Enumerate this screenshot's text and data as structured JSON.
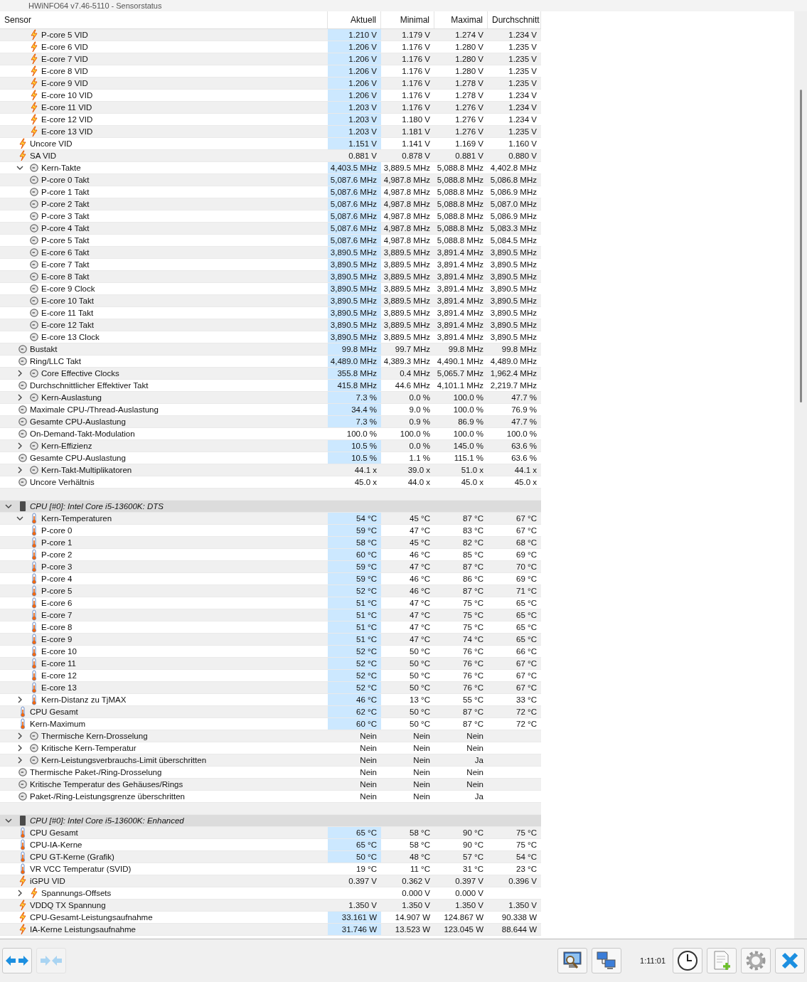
{
  "window": {
    "title": "HWiNFO64 v7.46-5110 - Sensorstatus"
  },
  "columns": [
    "Sensor",
    "Aktuell",
    "Minimal",
    "Maximal",
    "Durchschnitt"
  ],
  "sections": [
    {
      "rows": [
        {
          "children": [
            {
              "label": "P-core 5 VID",
              "kind": "volt",
              "highlighted": true,
              "current": "1.210 V",
              "min": "1.179 V",
              "max": "1.274 V",
              "avg": "1.234 V"
            },
            {
              "label": "E-core 6 VID",
              "kind": "volt",
              "highlighted": true,
              "current": "1.206 V",
              "min": "1.176 V",
              "max": "1.280 V",
              "avg": "1.235 V"
            },
            {
              "label": "E-core 7 VID",
              "kind": "volt",
              "highlighted": true,
              "current": "1.206 V",
              "min": "1.176 V",
              "max": "1.280 V",
              "avg": "1.235 V"
            },
            {
              "label": "E-core 8 VID",
              "kind": "volt",
              "highlighted": true,
              "current": "1.206 V",
              "min": "1.176 V",
              "max": "1.280 V",
              "avg": "1.235 V"
            },
            {
              "label": "E-core 9 VID",
              "kind": "volt",
              "highlighted": true,
              "current": "1.206 V",
              "min": "1.176 V",
              "max": "1.278 V",
              "avg": "1.235 V"
            },
            {
              "label": "E-core 10 VID",
              "kind": "volt",
              "highlighted": true,
              "current": "1.206 V",
              "min": "1.176 V",
              "max": "1.278 V",
              "avg": "1.234 V"
            },
            {
              "label": "E-core 11 VID",
              "kind": "volt",
              "highlighted": true,
              "current": "1.203 V",
              "min": "1.176 V",
              "max": "1.276 V",
              "avg": "1.234 V"
            },
            {
              "label": "E-core 12 VID",
              "kind": "volt",
              "highlighted": true,
              "current": "1.203 V",
              "min": "1.180 V",
              "max": "1.276 V",
              "avg": "1.234 V"
            },
            {
              "label": "E-core 13 VID",
              "kind": "volt",
              "highlighted": true,
              "current": "1.203 V",
              "min": "1.181 V",
              "max": "1.276 V",
              "avg": "1.235 V"
            }
          ]
        },
        {
          "label": "Uncore VID",
          "kind": "volt",
          "highlighted": true,
          "current": "1.151 V",
          "min": "1.141 V",
          "max": "1.169 V",
          "avg": "1.160 V"
        },
        {
          "label": "SA VID",
          "kind": "volt",
          "highlighted": false,
          "current": "0.881 V",
          "min": "0.878 V",
          "max": "0.881 V",
          "avg": "0.880 V"
        },
        {
          "label": "Kern-Takte",
          "kind": "gauge",
          "expanded": true,
          "highlighted": true,
          "current": "4,403.5 MHz",
          "min": "3,889.5 MHz",
          "max": "5,088.8 MHz",
          "avg": "4,402.8 MHz",
          "children": [
            {
              "label": "P-core 0 Takt",
              "kind": "gauge",
              "highlighted": true,
              "current": "5,087.6 MHz",
              "min": "4,987.8 MHz",
              "max": "5,088.8 MHz",
              "avg": "5,086.8 MHz"
            },
            {
              "label": "P-core 1 Takt",
              "kind": "gauge",
              "highlighted": true,
              "current": "5,087.6 MHz",
              "min": "4,987.8 MHz",
              "max": "5,088.8 MHz",
              "avg": "5,086.9 MHz"
            },
            {
              "label": "P-core 2 Takt",
              "kind": "gauge",
              "highlighted": true,
              "current": "5,087.6 MHz",
              "min": "4,987.8 MHz",
              "max": "5,088.8 MHz",
              "avg": "5,087.0 MHz"
            },
            {
              "label": "P-core 3 Takt",
              "kind": "gauge",
              "highlighted": true,
              "current": "5,087.6 MHz",
              "min": "4,987.8 MHz",
              "max": "5,088.8 MHz",
              "avg": "5,086.9 MHz"
            },
            {
              "label": "P-core 4 Takt",
              "kind": "gauge",
              "highlighted": true,
              "current": "5,087.6 MHz",
              "min": "4,987.8 MHz",
              "max": "5,088.8 MHz",
              "avg": "5,083.3 MHz"
            },
            {
              "label": "P-core 5 Takt",
              "kind": "gauge",
              "highlighted": true,
              "current": "5,087.6 MHz",
              "min": "4,987.8 MHz",
              "max": "5,088.8 MHz",
              "avg": "5,084.5 MHz"
            },
            {
              "label": "E-core 6 Takt",
              "kind": "gauge",
              "highlighted": true,
              "current": "3,890.5 MHz",
              "min": "3,889.5 MHz",
              "max": "3,891.4 MHz",
              "avg": "3,890.5 MHz"
            },
            {
              "label": "E-core 7 Takt",
              "kind": "gauge",
              "highlighted": true,
              "current": "3,890.5 MHz",
              "min": "3,889.5 MHz",
              "max": "3,891.4 MHz",
              "avg": "3,890.5 MHz"
            },
            {
              "label": "E-core 8 Takt",
              "kind": "gauge",
              "highlighted": true,
              "current": "3,890.5 MHz",
              "min": "3,889.5 MHz",
              "max": "3,891.4 MHz",
              "avg": "3,890.5 MHz"
            },
            {
              "label": "E-core 9 Clock",
              "kind": "gauge",
              "highlighted": true,
              "current": "3,890.5 MHz",
              "min": "3,889.5 MHz",
              "max": "3,891.4 MHz",
              "avg": "3,890.5 MHz"
            },
            {
              "label": "E-core 10 Takt",
              "kind": "gauge",
              "highlighted": true,
              "current": "3,890.5 MHz",
              "min": "3,889.5 MHz",
              "max": "3,891.4 MHz",
              "avg": "3,890.5 MHz"
            },
            {
              "label": "E-core 11 Takt",
              "kind": "gauge",
              "highlighted": true,
              "current": "3,890.5 MHz",
              "min": "3,889.5 MHz",
              "max": "3,891.4 MHz",
              "avg": "3,890.5 MHz"
            },
            {
              "label": "E-core 12 Takt",
              "kind": "gauge",
              "highlighted": true,
              "current": "3,890.5 MHz",
              "min": "3,889.5 MHz",
              "max": "3,891.4 MHz",
              "avg": "3,890.5 MHz"
            },
            {
              "label": "E-core 13 Clock",
              "kind": "gauge",
              "highlighted": true,
              "current": "3,890.5 MHz",
              "min": "3,889.5 MHz",
              "max": "3,891.4 MHz",
              "avg": "3,890.5 MHz"
            }
          ]
        },
        {
          "label": "Bustakt",
          "kind": "gauge",
          "highlighted": true,
          "current": "99.8 MHz",
          "min": "99.7 MHz",
          "max": "99.8 MHz",
          "avg": "99.8 MHz"
        },
        {
          "label": "Ring/LLC Takt",
          "kind": "gauge",
          "highlighted": true,
          "current": "4,489.0 MHz",
          "min": "4,389.3 MHz",
          "max": "4,490.1 MHz",
          "avg": "4,489.0 MHz"
        },
        {
          "label": "Core Effective Clocks",
          "kind": "gauge",
          "expanded": false,
          "highlighted": true,
          "current": "355.8 MHz",
          "min": "0.4 MHz",
          "max": "5,065.7 MHz",
          "avg": "1,962.4 MHz"
        },
        {
          "label": "Durchschnittlicher Effektiver Takt",
          "kind": "gauge",
          "highlighted": true,
          "current": "415.8 MHz",
          "min": "44.6 MHz",
          "max": "4,101.1 MHz",
          "avg": "2,219.7 MHz"
        },
        {
          "label": "Kern-Auslastung",
          "kind": "gauge",
          "expanded": false,
          "highlighted": true,
          "current": "7.3 %",
          "min": "0.0 %",
          "max": "100.0 %",
          "avg": "47.7 %"
        },
        {
          "label": "Maximale CPU-/Thread-Auslastung",
          "kind": "gauge",
          "highlighted": true,
          "current": "34.4 %",
          "min": "9.0 %",
          "max": "100.0 %",
          "avg": "76.9 %"
        },
        {
          "label": "Gesamte CPU-Auslastung",
          "kind": "gauge",
          "highlighted": true,
          "current": "7.3 %",
          "min": "0.9 %",
          "max": "86.9 %",
          "avg": "47.7 %"
        },
        {
          "label": "On-Demand-Takt-Modulation",
          "kind": "gauge",
          "highlighted": false,
          "current": "100.0 %",
          "min": "100.0 %",
          "max": "100.0 %",
          "avg": "100.0 %"
        },
        {
          "label": "Kern-Effizienz",
          "kind": "gauge",
          "expanded": false,
          "highlighted": true,
          "current": "10.5 %",
          "min": "0.0 %",
          "max": "145.0 %",
          "avg": "63.6 %"
        },
        {
          "label": "Gesamte CPU-Auslastung",
          "kind": "gauge",
          "highlighted": true,
          "current": "10.5 %",
          "min": "1.1 %",
          "max": "115.1 %",
          "avg": "63.6 %"
        },
        {
          "label": "Kern-Takt-Multiplikatoren",
          "kind": "gauge",
          "expanded": false,
          "highlighted": false,
          "current": "44.1 x",
          "min": "39.0 x",
          "max": "51.0 x",
          "avg": "44.1 x"
        },
        {
          "label": "Uncore Verhältnis",
          "kind": "gauge",
          "highlighted": false,
          "current": "45.0 x",
          "min": "44.0 x",
          "max": "45.0 x",
          "avg": "45.0 x"
        }
      ]
    },
    {
      "title": "CPU [#0]: Intel Core i5-13600K: DTS",
      "expanded": true,
      "rows": [
        {
          "label": "Kern-Temperaturen",
          "kind": "temp",
          "expanded": true,
          "highlighted": true,
          "current": "54 °C",
          "min": "45 °C",
          "max": "87 °C",
          "avg": "67 °C",
          "children": [
            {
              "label": "P-core 0",
              "kind": "temp",
              "highlighted": true,
              "current": "59 °C",
              "min": "47 °C",
              "max": "83 °C",
              "avg": "67 °C"
            },
            {
              "label": "P-core 1",
              "kind": "temp",
              "highlighted": true,
              "current": "58 °C",
              "min": "45 °C",
              "max": "82 °C",
              "avg": "68 °C"
            },
            {
              "label": "P-core 2",
              "kind": "temp",
              "highlighted": true,
              "current": "60 °C",
              "min": "46 °C",
              "max": "85 °C",
              "avg": "69 °C"
            },
            {
              "label": "P-core 3",
              "kind": "temp",
              "highlighted": true,
              "current": "59 °C",
              "min": "47 °C",
              "max": "87 °C",
              "avg": "70 °C"
            },
            {
              "label": "P-core 4",
              "kind": "temp",
              "highlighted": true,
              "current": "59 °C",
              "min": "46 °C",
              "max": "86 °C",
              "avg": "69 °C"
            },
            {
              "label": "P-core 5",
              "kind": "temp",
              "highlighted": true,
              "current": "52 °C",
              "min": "46 °C",
              "max": "87 °C",
              "avg": "71 °C"
            },
            {
              "label": "E-core 6",
              "kind": "temp",
              "highlighted": true,
              "current": "51 °C",
              "min": "47 °C",
              "max": "75 °C",
              "avg": "65 °C"
            },
            {
              "label": "E-core 7",
              "kind": "temp",
              "highlighted": true,
              "current": "51 °C",
              "min": "47 °C",
              "max": "75 °C",
              "avg": "65 °C"
            },
            {
              "label": "E-core 8",
              "kind": "temp",
              "highlighted": true,
              "current": "51 °C",
              "min": "47 °C",
              "max": "75 °C",
              "avg": "65 °C"
            },
            {
              "label": "E-core 9",
              "kind": "temp",
              "highlighted": true,
              "current": "51 °C",
              "min": "47 °C",
              "max": "74 °C",
              "avg": "65 °C"
            },
            {
              "label": "E-core 10",
              "kind": "temp",
              "highlighted": true,
              "current": "52 °C",
              "min": "50 °C",
              "max": "76 °C",
              "avg": "66 °C"
            },
            {
              "label": "E-core 11",
              "kind": "temp",
              "highlighted": true,
              "current": "52 °C",
              "min": "50 °C",
              "max": "76 °C",
              "avg": "67 °C"
            },
            {
              "label": "E-core 12",
              "kind": "temp",
              "highlighted": true,
              "current": "52 °C",
              "min": "50 °C",
              "max": "76 °C",
              "avg": "67 °C"
            },
            {
              "label": "E-core 13",
              "kind": "temp",
              "highlighted": true,
              "current": "52 °C",
              "min": "50 °C",
              "max": "76 °C",
              "avg": "67 °C"
            }
          ]
        },
        {
          "label": "Kern-Distanz zu TjMAX",
          "kind": "temp",
          "expanded": false,
          "highlighted": true,
          "current": "46 °C",
          "min": "13 °C",
          "max": "55 °C",
          "avg": "33 °C"
        },
        {
          "label": "CPU Gesamt",
          "kind": "temp",
          "highlighted": true,
          "current": "62 °C",
          "min": "50 °C",
          "max": "87 °C",
          "avg": "72 °C"
        },
        {
          "label": "Kern-Maximum",
          "kind": "temp",
          "highlighted": true,
          "current": "60 °C",
          "min": "50 °C",
          "max": "87 °C",
          "avg": "72 °C"
        },
        {
          "label": "Thermische Kern-Drosselung",
          "kind": "gauge",
          "expanded": false,
          "highlighted": false,
          "current": "Nein",
          "min": "Nein",
          "max": "Nein"
        },
        {
          "label": "Kritische Kern-Temperatur",
          "kind": "gauge",
          "expanded": false,
          "highlighted": false,
          "current": "Nein",
          "min": "Nein",
          "max": "Nein"
        },
        {
          "label": "Kern-Leistungsverbrauchs-Limit überschritten",
          "kind": "gauge",
          "expanded": false,
          "highlighted": false,
          "current": "Nein",
          "min": "Nein",
          "max": "Ja"
        },
        {
          "label": "Thermische Paket-/Ring-Drosselung",
          "kind": "gauge",
          "highlighted": false,
          "current": "Nein",
          "min": "Nein",
          "max": "Nein"
        },
        {
          "label": "Kritische Temperatur des Gehäuses/Rings",
          "kind": "gauge",
          "highlighted": false,
          "current": "Nein",
          "min": "Nein",
          "max": "Nein"
        },
        {
          "label": "Paket-/Ring-Leistungsgrenze überschritten",
          "kind": "gauge",
          "highlighted": false,
          "current": "Nein",
          "min": "Nein",
          "max": "Ja"
        }
      ]
    },
    {
      "title": "CPU [#0]: Intel Core i5-13600K: Enhanced",
      "expanded": true,
      "rows": [
        {
          "label": "CPU Gesamt",
          "kind": "temp",
          "highlighted": true,
          "current": "65 °C",
          "min": "58 °C",
          "max": "90 °C",
          "avg": "75 °C"
        },
        {
          "label": "CPU-IA-Kerne",
          "kind": "temp",
          "highlighted": true,
          "current": "65 °C",
          "min": "58 °C",
          "max": "90 °C",
          "avg": "75 °C"
        },
        {
          "label": "CPU GT-Kerne (Grafik)",
          "kind": "temp",
          "highlighted": true,
          "current": "50 °C",
          "min": "48 °C",
          "max": "57 °C",
          "avg": "54 °C"
        },
        {
          "label": "VR VCC Temperatur (SVID)",
          "kind": "temp",
          "highlighted": false,
          "current": "19 °C",
          "min": "11 °C",
          "max": "31 °C",
          "avg": "23 °C"
        },
        {
          "label": "iGPU VID",
          "kind": "volt",
          "highlighted": false,
          "current": "0.397 V",
          "min": "0.362 V",
          "max": "0.397 V",
          "avg": "0.396 V"
        },
        {
          "label": "Spannungs-Offsets",
          "kind": "volt",
          "expanded": false,
          "min": "0.000 V",
          "max": "0.000 V"
        },
        {
          "label": "VDDQ TX Spannung",
          "kind": "volt",
          "highlighted": false,
          "current": "1.350 V",
          "min": "1.350 V",
          "max": "1.350 V",
          "avg": "1.350 V"
        },
        {
          "label": "CPU-Gesamt-Leistungsaufnahme",
          "kind": "volt",
          "highlighted": true,
          "current": "33.161 W",
          "min": "14.907 W",
          "max": "124.867 W",
          "avg": "90.338 W"
        },
        {
          "label": "IA-Kerne Leistungsaufnahme",
          "kind": "volt",
          "highlighted": true,
          "current": "31.746 W",
          "min": "13.523 W",
          "max": "123.045 W",
          "avg": "88.644 W"
        }
      ]
    }
  ],
  "nav_buttons": [
    {
      "disabled": false
    },
    {
      "disabled": true
    }
  ],
  "timer": "1:11:01"
}
